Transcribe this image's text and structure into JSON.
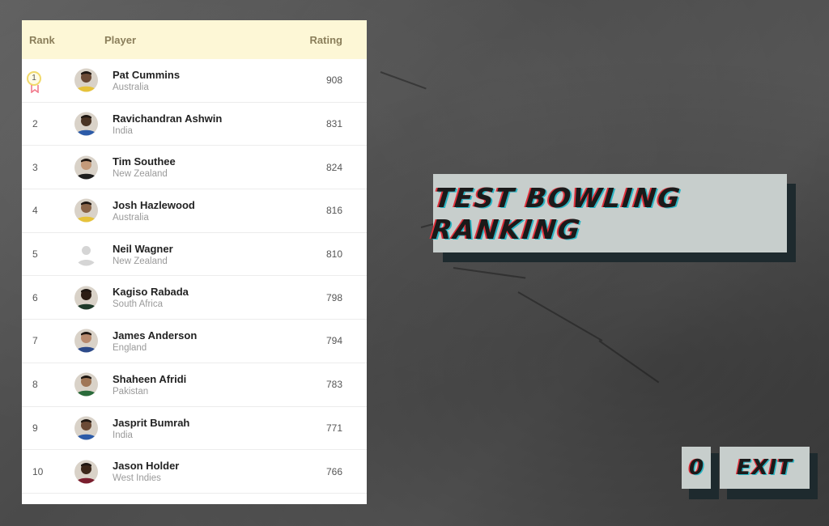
{
  "table": {
    "headers": {
      "rank": "Rank",
      "player": "Player",
      "rating": "Rating"
    },
    "rows": [
      {
        "rank": "1",
        "name": "Pat Cummins",
        "country": "Australia",
        "rating": "908",
        "avatar": "player-photo"
      },
      {
        "rank": "2",
        "name": "Ravichandran Ashwin",
        "country": "India",
        "rating": "831",
        "avatar": "player-photo"
      },
      {
        "rank": "3",
        "name": "Tim Southee",
        "country": "New Zealand",
        "rating": "824",
        "avatar": "player-photo"
      },
      {
        "rank": "4",
        "name": "Josh Hazlewood",
        "country": "Australia",
        "rating": "816",
        "avatar": "player-photo"
      },
      {
        "rank": "5",
        "name": "Neil Wagner",
        "country": "New Zealand",
        "rating": "810",
        "avatar": "placeholder-person"
      },
      {
        "rank": "6",
        "name": "Kagiso Rabada",
        "country": "South Africa",
        "rating": "798",
        "avatar": "player-photo"
      },
      {
        "rank": "7",
        "name": "James Anderson",
        "country": "England",
        "rating": "794",
        "avatar": "player-photo"
      },
      {
        "rank": "8",
        "name": "Shaheen Afridi",
        "country": "Pakistan",
        "rating": "783",
        "avatar": "player-photo"
      },
      {
        "rank": "9",
        "name": "Jasprit Bumrah",
        "country": "India",
        "rating": "771",
        "avatar": "player-photo"
      },
      {
        "rank": "10",
        "name": "Jason Holder",
        "country": "West Indies",
        "rating": "766",
        "avatar": "player-photo"
      }
    ]
  },
  "banner": {
    "title": "TEST BOWLING RANKING"
  },
  "controls": {
    "score": "0",
    "exit_label": "EXIT"
  },
  "colors": {
    "header_bg": "#fdf7d6",
    "button_bg": "#c7cecc",
    "button_shadow": "#1e2a2e",
    "accent_red": "#e0313c",
    "accent_cyan": "#2bb5c4"
  }
}
